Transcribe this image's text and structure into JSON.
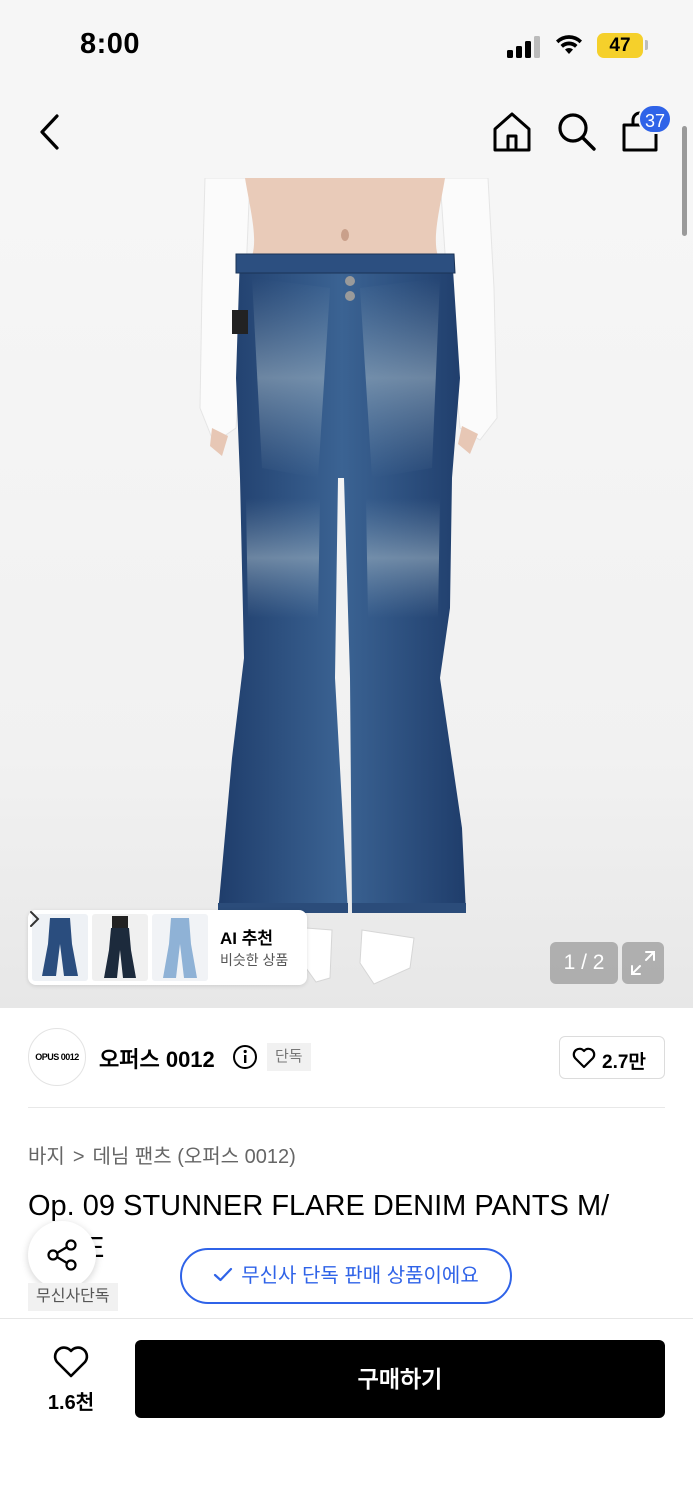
{
  "status_bar": {
    "time": "8:00",
    "battery": "47"
  },
  "header": {
    "cart_count": "37"
  },
  "gallery": {
    "ai_title": "AI 추천",
    "ai_subtitle": "비슷한 상품",
    "page_indicator": "1 / 2"
  },
  "brand": {
    "logo_text": "OPUS 0012",
    "name": "오퍼스 0012",
    "exclusive_tag": "단독",
    "like_count": "2.7만"
  },
  "breadcrumb": [
    "바지",
    "데님 팬츠 (오퍼스 0012)"
  ],
  "product": {
    "title_line1": "Op. 09 STUNNER FLARE DENIM PANTS M/",
    "title_line2": "E",
    "exclusive_badge": "무신사단독"
  },
  "toast": {
    "message": "무신사 단독 판매 상품이에요"
  },
  "bottom_bar": {
    "wish_count": "1.6천",
    "buy_label": "구매하기"
  },
  "colors": {
    "accent": "#2f63e8",
    "battery": "#f5d02b",
    "denim": "#2a4d7e"
  }
}
